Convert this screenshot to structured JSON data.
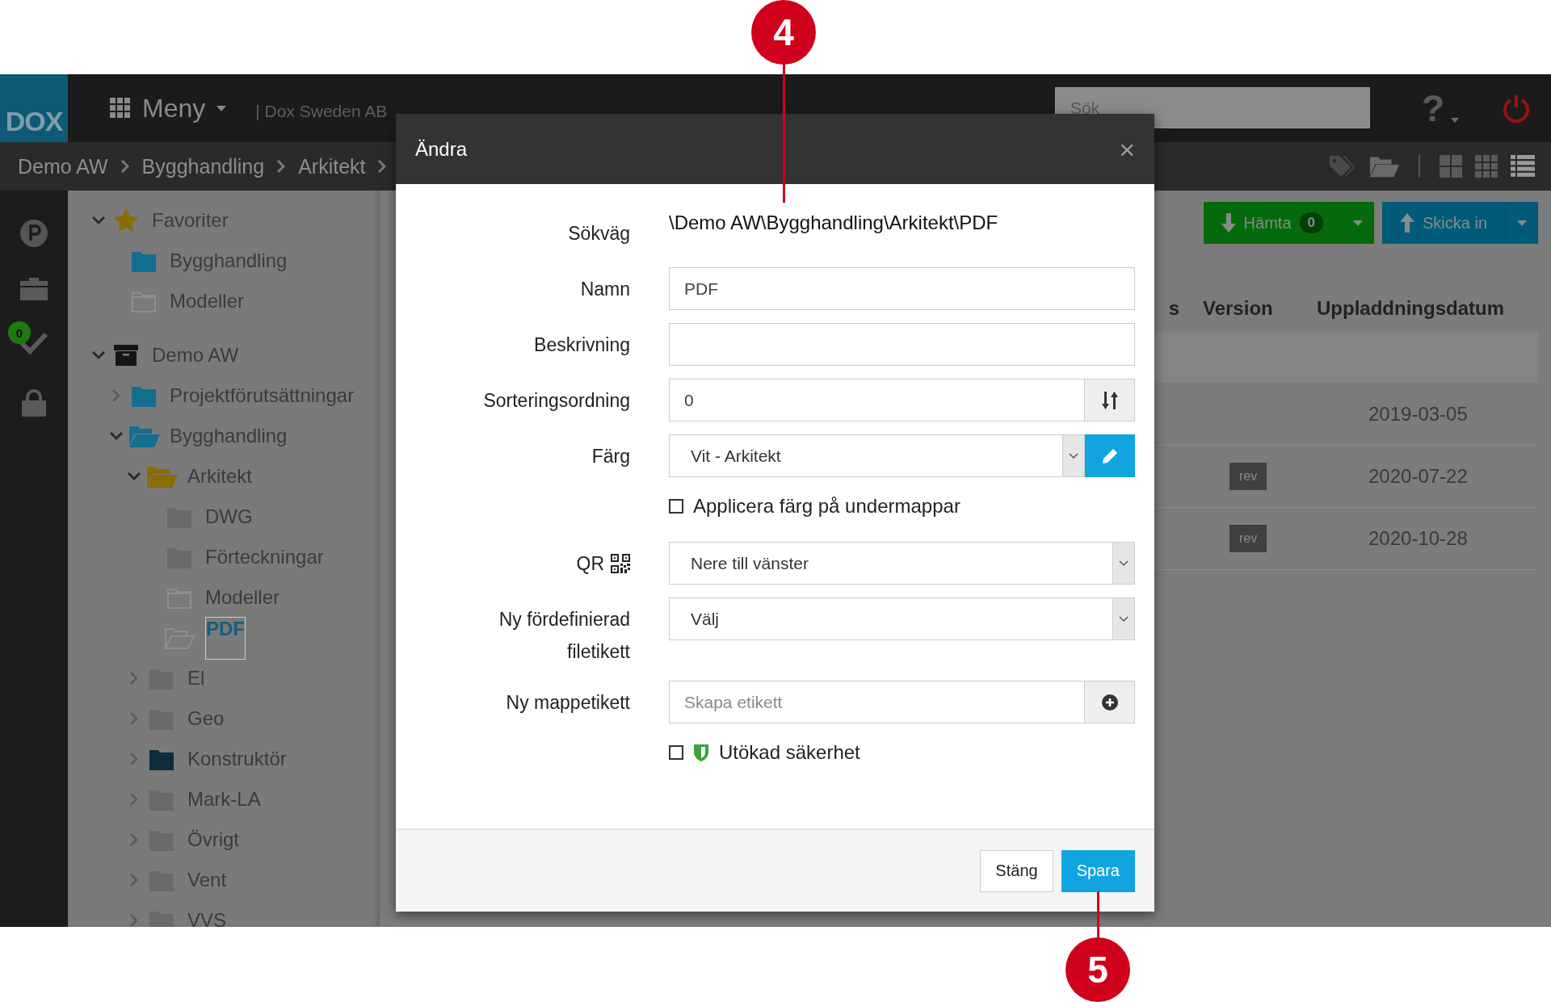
{
  "callouts": [
    {
      "number": "4"
    },
    {
      "number": "5"
    }
  ],
  "header": {
    "logo": "DOX",
    "menu": "Meny",
    "company": "| Dox Sweden AB",
    "search": {
      "placeholder": "Sök"
    },
    "help": "?"
  },
  "breadcrumb": [
    "Demo AW",
    "Bygghandling",
    "Arkitekt"
  ],
  "sidebar": {
    "badge": "0"
  },
  "tree": [
    {
      "label": "Favoriter",
      "kind": "star",
      "color": "#8a6d00",
      "expanded": true,
      "selected": false,
      "children": [
        {
          "label": "Bygghandling",
          "kind": "folder",
          "color": "#136f8f",
          "selected": false
        },
        {
          "label": "Modeller",
          "kind": "empty-folder",
          "color": "#8e8e8e",
          "selected": false
        }
      ]
    },
    {
      "label": "Demo AW",
      "kind": "archive",
      "color": "#151515",
      "expanded": true,
      "selected": false,
      "children": [
        {
          "label": "Projektförutsättningar",
          "kind": "folder",
          "color": "#136f8f",
          "expanded": false,
          "selected": false
        },
        {
          "label": "Bygghandling",
          "kind": "open-folder",
          "color": "#136f8f",
          "expanded": true,
          "selected": false,
          "children": [
            {
              "label": "Arkitekt",
              "kind": "open-folder",
              "color": "#8a6d00",
              "expanded": true,
              "selected": false,
              "children": [
                {
                  "label": "DWG",
                  "kind": "folder",
                  "color": "#6a6a6a",
                  "selected": false
                },
                {
                  "label": "Förteckningar",
                  "kind": "folder",
                  "color": "#6a6a6a",
                  "selected": false
                },
                {
                  "label": "Modeller",
                  "kind": "empty-folder",
                  "color": "#8e8e8e",
                  "selected": false
                },
                {
                  "label": "PDF",
                  "kind": "empty-open-folder",
                  "color": "#8e8e8e",
                  "selected": true
                }
              ]
            },
            {
              "label": "El",
              "kind": "folder",
              "color": "#6a6a6a",
              "expanded": false,
              "selected": false
            },
            {
              "label": "Geo",
              "kind": "folder",
              "color": "#6a6a6a",
              "expanded": false,
              "selected": false
            },
            {
              "label": "Konstruktör",
              "kind": "folder",
              "color": "#0e2c3a",
              "expanded": false,
              "selected": false
            },
            {
              "label": "Mark-LA",
              "kind": "folder",
              "color": "#6a6a6a",
              "expanded": false,
              "selected": false
            },
            {
              "label": "Övrigt",
              "kind": "folder",
              "color": "#6a6a6a",
              "expanded": false,
              "selected": false
            },
            {
              "label": "Vent",
              "kind": "folder",
              "color": "#6a6a6a",
              "expanded": false,
              "selected": false
            },
            {
              "label": "VVS",
              "kind": "folder",
              "color": "#6a6a6a",
              "expanded": false,
              "selected": false
            }
          ]
        }
      ]
    }
  ],
  "toolbar": {
    "download": {
      "label": "Hämta",
      "count": "0"
    },
    "upload": {
      "label": "Skicka in"
    }
  },
  "table": {
    "columns": [
      "s",
      "Version",
      "Uppladdningsdatum"
    ],
    "rows": [
      {
        "selected": true
      },
      {
        "selected": false,
        "date": "2019-03-05"
      },
      {
        "selected": false,
        "version": "rev",
        "date": "2020-07-22"
      },
      {
        "selected": false,
        "version": "rev",
        "date": "2020-10-28"
      }
    ]
  },
  "dialog": {
    "title": "Ändra",
    "close": "×",
    "path": {
      "label": "Sökväg",
      "value": "\\Demo AW\\Bygghandling\\Arkitekt\\PDF"
    },
    "fields": [
      {
        "kind": "text",
        "label": "Namn",
        "value": "PDF"
      },
      {
        "kind": "text",
        "label": "Beskrivning"
      },
      {
        "kind": "number",
        "label": "Sorteringsordning",
        "value": "0"
      },
      {
        "kind": "color",
        "label": "Färg",
        "value": "Vit - Arkitekt"
      },
      {
        "kind": "checkbox",
        "label": "Applicera färg på undermappar",
        "checked": false
      },
      {
        "kind": "qr-select",
        "label": "QR",
        "value": "Nere till vänster"
      },
      {
        "kind": "select",
        "label": "Ny fördefinierad filetikett",
        "value": "Välj"
      },
      {
        "kind": "tag-input",
        "label": "Ny mappetikett",
        "placeholder": "Skapa etikett"
      },
      {
        "kind": "secure-checkbox",
        "label": "Utökad säkerhet",
        "checked": false
      }
    ],
    "buttons": [
      {
        "label": "Stäng",
        "primary": false
      },
      {
        "label": "Spara",
        "primary": true
      }
    ]
  }
}
